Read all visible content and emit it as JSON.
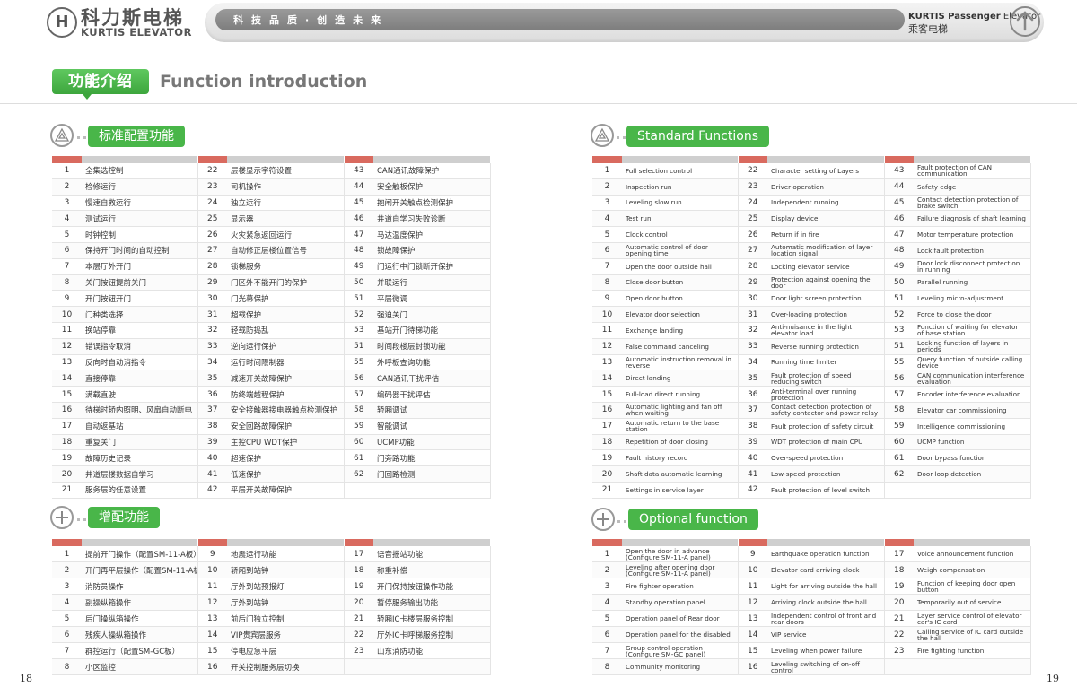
{
  "header": {
    "logo_mark": "H",
    "logo_cn": "科力斯电梯",
    "logo_en": "KURTIS ELEVATOR",
    "slogan": "科技品质·创造未来",
    "brand_en_bold": "KURTIS Passenger",
    "brand_en_light": "Elevator",
    "brand_cn": "乘客电梯"
  },
  "title": {
    "cn": "功能介绍",
    "en": "Function introduction"
  },
  "sections": {
    "standard_cn": "标准配置功能",
    "standard_en": "Standard Functions",
    "optional_cn": "增配功能",
    "optional_en": "Optional function"
  },
  "standard_cn": [
    [
      "1",
      "全集选控制",
      "22",
      "层楼显示字符设置",
      "43",
      "CAN通讯故障保护"
    ],
    [
      "2",
      "检修运行",
      "23",
      "司机操作",
      "44",
      "安全触板保护"
    ],
    [
      "3",
      "慢速自救运行",
      "24",
      "独立运行",
      "45",
      "抱闸开关触点检测保护"
    ],
    [
      "4",
      "测试运行",
      "25",
      "显示器",
      "46",
      "井道自学习失败诊断"
    ],
    [
      "5",
      "时钟控制",
      "26",
      "火灾紧急返回运行",
      "47",
      "马达温度保护"
    ],
    [
      "6",
      "保持开门时间的自动控制",
      "27",
      "自动修正层楼位置信号",
      "48",
      "锁故障保护"
    ],
    [
      "7",
      "本层厅外开门",
      "28",
      "锁梯服务",
      "49",
      "门运行中门锁断开保护"
    ],
    [
      "8",
      "关门按钮提前关门",
      "29",
      "门区外不能开门的保护",
      "50",
      "并联运行"
    ],
    [
      "9",
      "开门按钮开门",
      "30",
      "门光幕保护",
      "51",
      "平层微调"
    ],
    [
      "10",
      "门种类选择",
      "31",
      "超载保护",
      "52",
      "强迫关门"
    ],
    [
      "11",
      "换站停靠",
      "32",
      "轻载防捣乱",
      "53",
      "基站开门待梯功能"
    ],
    [
      "12",
      "错误指令取消",
      "33",
      "逆向运行保护",
      "51",
      "时间段楼层封锁功能"
    ],
    [
      "13",
      "反向时自动消指令",
      "34",
      "运行时间限制器",
      "55",
      "外呼板查询功能"
    ],
    [
      "14",
      "直接停靠",
      "35",
      "减速开关故障保护",
      "56",
      "CAN通讯干扰评估"
    ],
    [
      "15",
      "满载直驶",
      "36",
      "防终端越程保护",
      "57",
      "编码器干扰评估"
    ],
    [
      "16",
      "待梯时轿内照明、风扇自动断电",
      "37",
      "安全接触器接电器触点检测保护",
      "58",
      "轿厢调试"
    ],
    [
      "17",
      "自动返基站",
      "38",
      "安全回路故障保护",
      "59",
      "智能调试"
    ],
    [
      "18",
      "重复关门",
      "39",
      "主控CPU WDT保护",
      "60",
      "UCMP功能"
    ],
    [
      "19",
      "故障历史记录",
      "40",
      "超速保护",
      "61",
      "门旁路功能"
    ],
    [
      "20",
      "井道层楼数据自学习",
      "41",
      "低速保护",
      "62",
      "门回路检测"
    ],
    [
      "21",
      "服务层的任意设置",
      "42",
      "平层开关故障保护",
      "",
      ""
    ]
  ],
  "optional_cn": [
    [
      "1",
      "提前开门操作（配置SM-11-A板）",
      "9",
      "地震运行功能",
      "17",
      "语音报站功能"
    ],
    [
      "2",
      "开门再平层操作（配置SM-11-A板）",
      "10",
      "轿厢到站钟",
      "18",
      "称重补偿"
    ],
    [
      "3",
      "消防员操作",
      "11",
      "厅外到站预报灯",
      "19",
      "开门保持按钮操作功能"
    ],
    [
      "4",
      "副操纵箱操作",
      "12",
      "厅外到站钟",
      "20",
      "暂停服务输出功能"
    ],
    [
      "5",
      "后门操纵箱操作",
      "13",
      "前后门独立控制",
      "21",
      "轿厢IC卡楼层服务控制"
    ],
    [
      "6",
      "残疾人操纵箱操作",
      "14",
      "VIP贵宾层服务",
      "22",
      "厅外IC卡呼梯服务控制"
    ],
    [
      "7",
      "群控运行（配置SM-GC板）",
      "15",
      "停电应急平层",
      "23",
      "山东消防功能"
    ],
    [
      "8",
      "小区监控",
      "16",
      "开关控制服务层切换",
      "",
      ""
    ]
  ],
  "standard_en": [
    [
      "1",
      "Full selection control",
      "22",
      "Character setting of Layers",
      "43",
      "Fault protection of CAN communication"
    ],
    [
      "2",
      "Inspection run",
      "23",
      "Driver operation",
      "44",
      "Safety edge"
    ],
    [
      "3",
      "Leveling slow run",
      "24",
      "Independent running",
      "45",
      "Contact detection protection of brake switch"
    ],
    [
      "4",
      "Test run",
      "25",
      "Display device",
      "46",
      "Failure diagnosis of shaft learning"
    ],
    [
      "5",
      "Clock control",
      "26",
      "Return if in fire",
      "47",
      "Motor temperature protection"
    ],
    [
      "6",
      "Automatic control of door opening time",
      "27",
      "Automatic modification of layer location signal",
      "48",
      "Lock fault protection"
    ],
    [
      "7",
      "Open the door outside hall",
      "28",
      "Locking elevator service",
      "49",
      "Door lock disconnect protection in running"
    ],
    [
      "8",
      "Close door button",
      "29",
      "Protection against opening the door",
      "50",
      "Parallel running"
    ],
    [
      "9",
      "Open door button",
      "30",
      "Door light screen protection",
      "51",
      "Leveling micro-adjustment"
    ],
    [
      "10",
      "Elevator door selection",
      "31",
      "Over-loading protection",
      "52",
      "Force to close the door"
    ],
    [
      "11",
      "Exchange landing",
      "32",
      "Anti-nuisance in the light elevator load",
      "53",
      "Function of waiting for elevator of base station"
    ],
    [
      "12",
      "False command canceling",
      "33",
      "Reverse running protection",
      "51",
      "Locking function of layers in periods"
    ],
    [
      "13",
      "Automatic instruction removal in reverse",
      "34",
      "Running time limiter",
      "55",
      "Query function of outside calling device"
    ],
    [
      "14",
      "Direct landing",
      "35",
      "Fault protection of speed reducing switch",
      "56",
      "CAN communication interference evaluation"
    ],
    [
      "15",
      "Full-load direct running",
      "36",
      "Anti-terminal over running protection",
      "57",
      "Encoder interference evaluation"
    ],
    [
      "16",
      "Automatic lighting and fan off when waiting",
      "37",
      "Contact detection protection of safety contactor and power relay",
      "58",
      "Elevator car commissioning"
    ],
    [
      "17",
      "Automatic return to the base station",
      "38",
      "Fault protection of safety circuit",
      "59",
      "Intelligence commissioning"
    ],
    [
      "18",
      "Repetition of door closing",
      "39",
      "WDT protection of main CPU",
      "60",
      "UCMP function"
    ],
    [
      "19",
      "Fault history record",
      "40",
      "Over-speed protection",
      "61",
      "Door bypass function"
    ],
    [
      "20",
      "Shaft data automatic learning",
      "41",
      "Low-speed protection",
      "62",
      "Door loop detection"
    ],
    [
      "21",
      "Settings in service layer",
      "42",
      "Fault protection of level switch",
      "",
      ""
    ]
  ],
  "optional_en": [
    [
      "1",
      "Open the door in advance (Configure SM-11-A panel)",
      "9",
      "Earthquake operation function",
      "17",
      "Voice announcement function"
    ],
    [
      "2",
      "Leveling after opening door (Configure SM-11-A panel)",
      "10",
      "Elevator card arriving clock",
      "18",
      "Weigh compensation"
    ],
    [
      "3",
      "Fire fighter operation",
      "11",
      "Light for arriving outside the hall",
      "19",
      "Function of keeping door open button"
    ],
    [
      "4",
      "Standby operation panel",
      "12",
      "Arriving clock outside the hall",
      "20",
      "Temporarily out of service"
    ],
    [
      "5",
      "Operation panel of Rear door",
      "13",
      "Independent control of front and rear doors",
      "21",
      "Layer service control of elevator car's IC card"
    ],
    [
      "6",
      "Operation panel for the disabled",
      "14",
      "VIP service",
      "22",
      "Calling service of IC card outside the hall"
    ],
    [
      "7",
      "Group control operation (Configure SM-GC panel)",
      "15",
      "Leveling when power failure",
      "23",
      "Fire fighting function"
    ],
    [
      "8",
      "Community monitoring",
      "16",
      "Leveling switching of on-off control",
      "",
      ""
    ]
  ],
  "page_numbers": {
    "left": "18",
    "right": "19"
  }
}
